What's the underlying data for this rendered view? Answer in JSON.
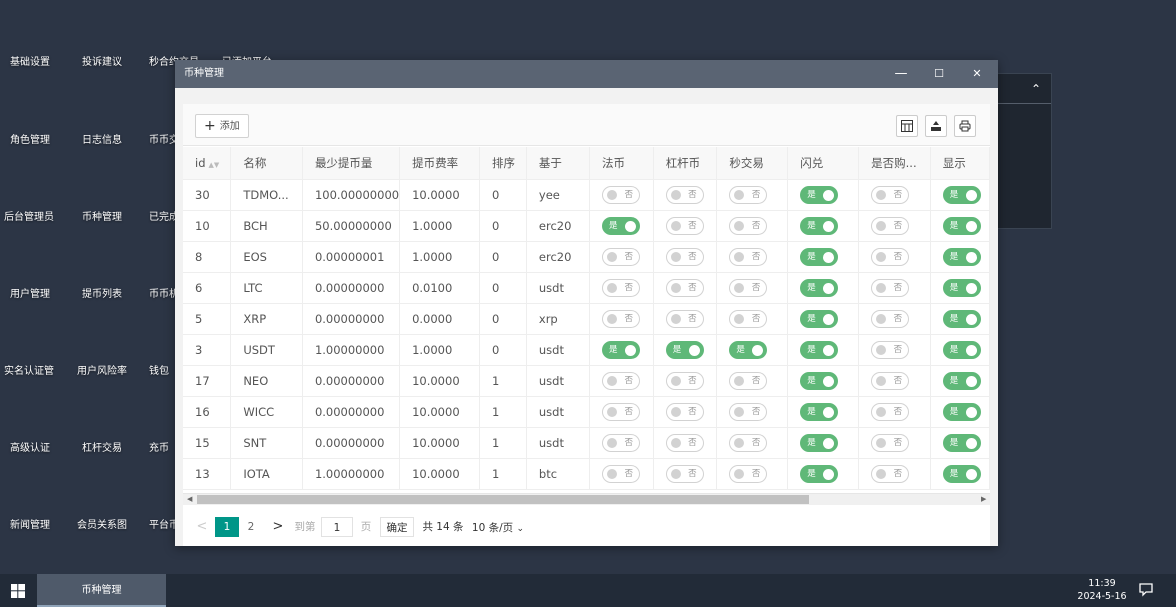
{
  "desktop": {
    "icons": [
      [
        "基础设置",
        "投诉建议",
        "秒合约交易",
        "已添加平台"
      ],
      [
        "角色管理",
        "日志信息",
        "币币交"
      ],
      [
        "后台管理员",
        "币种管理",
        "已完成"
      ],
      [
        "用户管理",
        "提币列表",
        "币币机"
      ],
      [
        "实名认证管",
        "用户风险率",
        "钱包"
      ],
      [
        "高级认证",
        "杠杆交易",
        "充币"
      ],
      [
        "新闻管理",
        "会员关系图",
        "平台币"
      ]
    ]
  },
  "window": {
    "title": "币种管理",
    "controls": {
      "minimize": "—",
      "maximize": "☐",
      "close": "✕"
    }
  },
  "toolbar": {
    "add_label": "添加",
    "add_icon": "plus-icon",
    "right_icons": [
      "columns-icon",
      "export-icon",
      "print-icon"
    ]
  },
  "table": {
    "columns": [
      "id",
      "名称",
      "最少提币量",
      "提币费率",
      "排序",
      "基于",
      "法币",
      "杠杆币",
      "秒交易",
      "闪兑",
      "是否购...",
      "显示"
    ],
    "switch_on": "是",
    "switch_off": "否",
    "rows": [
      {
        "id": "30",
        "name": "TDMO...",
        "min": "100.00000000",
        "fee": "10.0000",
        "sort": "0",
        "base": "yee",
        "legal": false,
        "lever": false,
        "sec": false,
        "flash": true,
        "buy": false,
        "show": true
      },
      {
        "id": "10",
        "name": "BCH",
        "min": "50.00000000",
        "fee": "1.0000",
        "sort": "0",
        "base": "erc20",
        "legal": true,
        "lever": false,
        "sec": false,
        "flash": true,
        "buy": false,
        "show": true
      },
      {
        "id": "8",
        "name": "EOS",
        "min": "0.00000001",
        "fee": "1.0000",
        "sort": "0",
        "base": "erc20",
        "legal": false,
        "lever": false,
        "sec": false,
        "flash": true,
        "buy": false,
        "show": true
      },
      {
        "id": "6",
        "name": "LTC",
        "min": "0.00000000",
        "fee": "0.0100",
        "sort": "0",
        "base": "usdt",
        "legal": false,
        "lever": false,
        "sec": false,
        "flash": true,
        "buy": false,
        "show": true
      },
      {
        "id": "5",
        "name": "XRP",
        "min": "0.00000000",
        "fee": "0.0000",
        "sort": "0",
        "base": "xrp",
        "legal": false,
        "lever": false,
        "sec": false,
        "flash": true,
        "buy": false,
        "show": true
      },
      {
        "id": "3",
        "name": "USDT",
        "min": "1.00000000",
        "fee": "1.0000",
        "sort": "0",
        "base": "usdt",
        "legal": true,
        "lever": true,
        "sec": true,
        "flash": true,
        "buy": false,
        "show": true
      },
      {
        "id": "17",
        "name": "NEO",
        "min": "0.00000000",
        "fee": "10.0000",
        "sort": "1",
        "base": "usdt",
        "legal": false,
        "lever": false,
        "sec": false,
        "flash": true,
        "buy": false,
        "show": true
      },
      {
        "id": "16",
        "name": "WICC",
        "min": "0.00000000",
        "fee": "10.0000",
        "sort": "1",
        "base": "usdt",
        "legal": false,
        "lever": false,
        "sec": false,
        "flash": true,
        "buy": false,
        "show": true
      },
      {
        "id": "15",
        "name": "SNT",
        "min": "0.00000000",
        "fee": "10.0000",
        "sort": "1",
        "base": "usdt",
        "legal": false,
        "lever": false,
        "sec": false,
        "flash": true,
        "buy": false,
        "show": true
      },
      {
        "id": "13",
        "name": "IOTA",
        "min": "1.00000000",
        "fee": "10.0000",
        "sort": "1",
        "base": "btc",
        "legal": false,
        "lever": false,
        "sec": false,
        "flash": true,
        "buy": false,
        "show": true
      }
    ]
  },
  "pager": {
    "prev": "<",
    "pages": [
      "1",
      "2"
    ],
    "current": "1",
    "next": ">",
    "goto_label": "到第",
    "goto_value": "1",
    "page_unit": "页",
    "confirm": "确定",
    "total": "共 14 条",
    "per_page": "10 条/页"
  },
  "taskbar": {
    "task_label": "币种管理",
    "time": "11:39",
    "date": "2024-5-16"
  },
  "colors": {
    "switch_on": "#5fb878",
    "page_current": "#009688",
    "title_bar": "#5a6473",
    "desktop": "#2c3545"
  }
}
